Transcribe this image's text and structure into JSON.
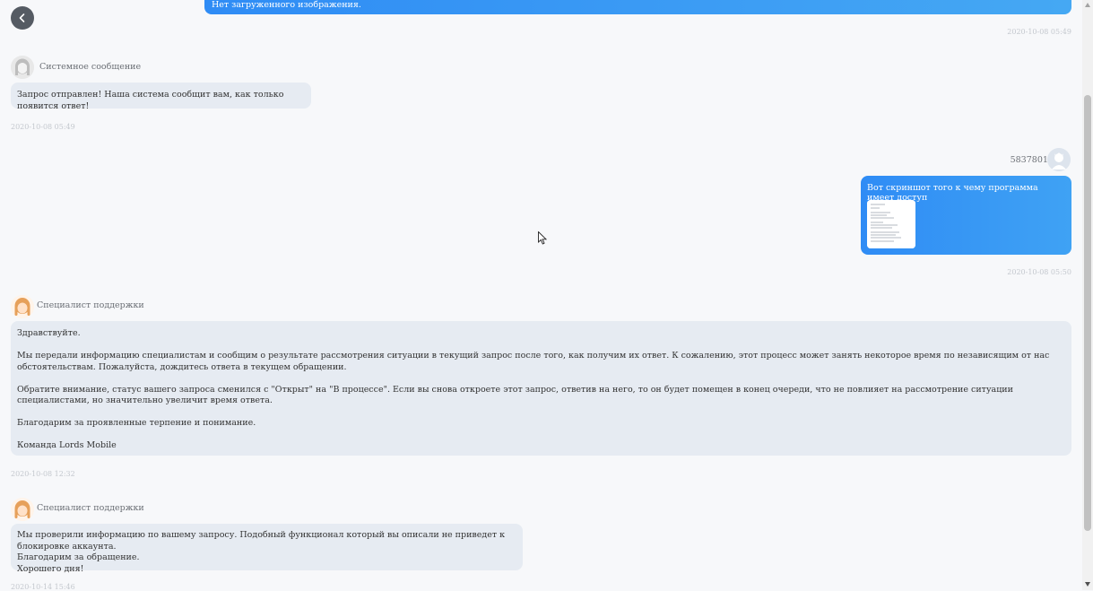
{
  "top_message": {
    "text": "Нет загруженного изображения.",
    "timestamp": "2020-10-08 05:49"
  },
  "system_message": {
    "sender": "Системное сообщение",
    "text": "Запрос отправлен! Наша система сообщит вам, как только появится ответ!",
    "timestamp": "2020-10-08 05:49"
  },
  "user_message": {
    "sender": "583780155",
    "text": "Вот скриншот того к чему программа имеет доступ",
    "timestamp": "2020-10-08 05:50"
  },
  "support_message_1": {
    "sender": "Специалист поддержки",
    "paragraphs": [
      "Здравствуйте.",
      "Мы передали информацию специалистам и сообщим о результате рассмотрения ситуации в текущий запрос после того, как получим их ответ. К сожалению, этот процесс может занять некоторое время по независящим от нас обстоятельствам. Пожалуйста, дождитесь ответа в текущем обращении.",
      "Обратите внимание, статус вашего запроса сменился с \"Открыт\" на \"В процессе\". Если вы снова откроете этот запрос, ответив на него, то он будет помещен в конец очереди, что не повлияет на рассмотрение ситуации специалистами, но значительно увеличит время ответа.",
      "Благодарим за проявленные терпение и понимание.",
      "Команда Lords Mobile"
    ],
    "timestamp": "2020-10-08 12:32"
  },
  "support_message_2": {
    "sender": "Специалист поддержки",
    "lines": [
      "Мы проверили информацию по вашему запросу. Подобный функционал который вы описали не приведет к блокировке аккаунта.",
      "Благодарим за обращение.",
      "Хорошего дня!"
    ],
    "timestamp": "2020-10-14 15:46"
  }
}
